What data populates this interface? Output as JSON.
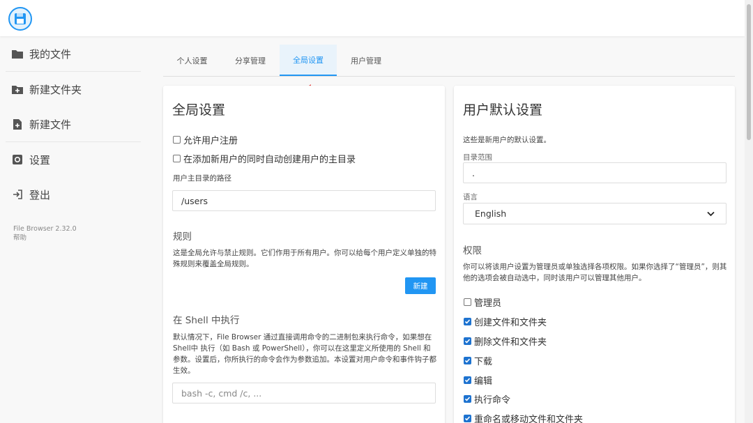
{
  "header": {
    "logo_icon": "floppy-disk-icon"
  },
  "sidebar": {
    "items": [
      {
        "label": "我的文件",
        "icon": "folder-icon"
      },
      {
        "label": "新建文件夹",
        "icon": "folder-plus-icon"
      },
      {
        "label": "新建文件",
        "icon": "file-plus-icon"
      },
      {
        "label": "设置",
        "icon": "gear-icon"
      },
      {
        "label": "登出",
        "icon": "logout-icon"
      }
    ],
    "version": "File Browser 2.32.0",
    "help": "帮助"
  },
  "tabs": [
    {
      "label": "个人设置",
      "active": false
    },
    {
      "label": "分享管理",
      "active": false
    },
    {
      "label": "全局设置",
      "active": true
    },
    {
      "label": "用户管理",
      "active": false
    }
  ],
  "global": {
    "title": "全局设置",
    "allow_signup": {
      "label": "允许用户注册",
      "checked": false
    },
    "create_home": {
      "label": "在添加新用户的同时自动创建用户的主目录",
      "checked": false
    },
    "home_path_label": "用户主目录的路径",
    "home_path_value": "/users",
    "rules": {
      "title": "规则",
      "description": "这是全局允许与禁止规则。它们作用于所有用户。你可以给每个用户定义单独的特殊规则来覆盖全局规则。",
      "new_button": "新建"
    },
    "shell": {
      "title": "在 Shell 中执行",
      "description": "默认情况下，File Browser 通过直接调用命令的二进制包来执行命令，如果想在Shell中 执行（如 Bash 或 PowerShell），你可以在这里定义所使用的 Shell 和参数。设置后，你所执行的命令会作为参数追加。本设置对用户命令和事件钩子都生效。",
      "placeholder": "bash -c, cmd /c, ..."
    }
  },
  "user_defaults": {
    "title": "用户默认设置",
    "description": "这些是新用户的默认设置。",
    "scope_label": "目录范围",
    "scope_value": ".",
    "language_label": "语言",
    "language_value": "English",
    "permissions": {
      "title": "权限",
      "description": "你可以将该用户设置为管理员或单独选择各项权限。如果你选择了“管理员”，则其他的选项会被自动选中，同时该用户可以管理其他用户。",
      "items": [
        {
          "label": "管理员",
          "checked": false
        },
        {
          "label": "创建文件和文件夹",
          "checked": true
        },
        {
          "label": "删除文件和文件夹",
          "checked": true
        },
        {
          "label": "下载",
          "checked": true
        },
        {
          "label": "编辑",
          "checked": true
        },
        {
          "label": "执行命令",
          "checked": true
        },
        {
          "label": "重命名或移动文件和文件夹",
          "checked": true
        }
      ]
    }
  },
  "colors": {
    "accent": "#2196f3",
    "checkbox": "#1e73d0",
    "arrow": "#e53935"
  }
}
